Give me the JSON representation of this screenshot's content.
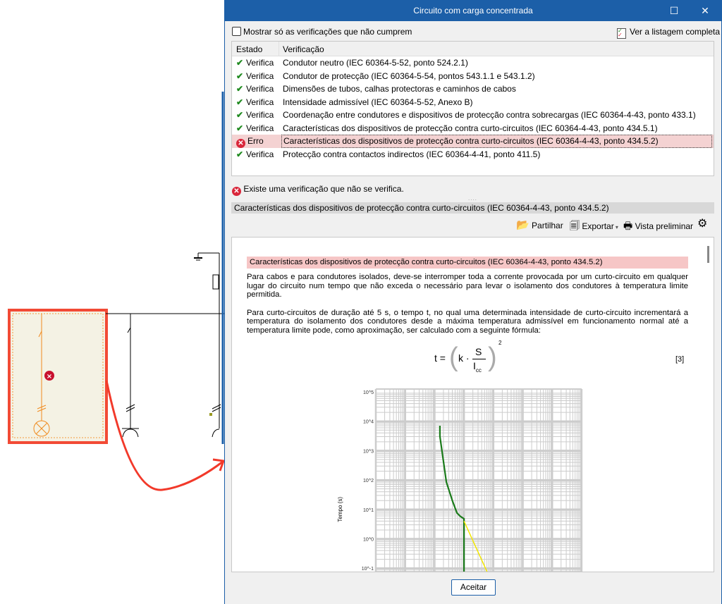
{
  "window": {
    "title": "Circuito com carga concentrada",
    "maximize_icon": "maximize-icon",
    "close_icon": "close-icon"
  },
  "filter": {
    "checkbox_label": "Mostrar só as verificações que não cumprem",
    "checked": false
  },
  "full_list_link": "Ver a listagem completa",
  "table": {
    "headers": [
      "Estado",
      "Verificação"
    ],
    "rows": [
      {
        "status": "Verifica",
        "check": "Condutor neutro (IEC 60364-5-52, ponto 524.2.1)",
        "ok": true
      },
      {
        "status": "Verifica",
        "check": "Condutor de protecção (IEC 60364-5-54, pontos 543.1.1 e 543.1.2)",
        "ok": true
      },
      {
        "status": "Verifica",
        "check": "Dimensões de tubos, calhas protectoras e caminhos de cabos",
        "ok": true
      },
      {
        "status": "Verifica",
        "check": "Intensidade admissível (IEC 60364-5-52, Anexo B)",
        "ok": true
      },
      {
        "status": "Verifica",
        "check": "Coordenação entre condutores e dispositivos de protecção contra sobrecargas (IEC 60364-4-43, ponto 433.1)",
        "ok": true
      },
      {
        "status": "Verifica",
        "check": "Características dos dispositivos de protecção contra curto-circuitos (IEC 60364-4-43, ponto 434.5.1)",
        "ok": true
      },
      {
        "status": "Erro",
        "check": "Características dos dispositivos de protecção contra curto-circuitos (IEC 60364-4-43, ponto 434.5.2)",
        "ok": false
      },
      {
        "status": "Verifica",
        "check": "Protecção contra contactos indirectos (IEC 60364-4-41, ponto 411.5)",
        "ok": true
      }
    ]
  },
  "status_message": "Existe uma verificação que não se verifica.",
  "section_title": "Características dos dispositivos de protecção contra curto-circuitos (IEC 60364-4-43, ponto 434.5.2)",
  "toolbar": {
    "share": "Partilhar",
    "export": "Exportar",
    "preview": "Vista preliminar"
  },
  "doc": {
    "heading": "Características dos dispositivos de protecção contra curto-circuitos (IEC 60364-4-43, ponto 434.5.2)",
    "p1": "Para cabos e para condutores isolados, deve-se interromper toda a corrente provocada por um curto-circuito em qualquer lugar do circuito num tempo que não exceda o necessário para levar o isolamento dos condutores à temperatura limite permitida.",
    "p2": "Para curto-circuitos de duração até 5 s, o tempo t, no qual uma determinada intensidade de curto-circuito incrementará a temperatura do isolamento dos condutores desde a máxima temperatura admissível em funcionamento normal até a temperatura limite pode, como aproximação, ser calculado com a seguinte fórmula:",
    "formula": {
      "lhs": "t =",
      "k": "k ·",
      "num": "S",
      "den": "I",
      "den_sub": "cc",
      "exp": "2",
      "ref": "[3]"
    }
  },
  "chart_data": {
    "type": "line",
    "ylabel": "Tempo (s)",
    "yscale": "log",
    "y_ticks": [
      "10^5",
      "10^4",
      "10^3",
      "10^2",
      "10^1",
      "10^0",
      "10^-1"
    ],
    "y_tick_exponents": [
      5,
      4,
      3,
      2,
      1,
      0,
      -1
    ],
    "ylim_log": [
      -1,
      5
    ],
    "x_decades": 7,
    "grid": true,
    "series": [
      {
        "name": "device-curve",
        "color": "#1a7a1a",
        "points_log": [
          [
            2.18,
            3.85
          ],
          [
            2.18,
            3.49
          ],
          [
            2.4,
            1.93
          ],
          [
            2.61,
            1.28
          ],
          [
            2.76,
            0.88
          ],
          [
            2.88,
            0.76
          ],
          [
            3.0,
            0.68
          ],
          [
            3.0,
            -1.2
          ]
        ]
      },
      {
        "name": "cable-limit",
        "color": "#f2e600",
        "points_log": [
          [
            3.0,
            0.6
          ],
          [
            3.82,
            -1.2
          ]
        ]
      }
    ]
  },
  "footer": {
    "accept": "Aceitar"
  },
  "colors": {
    "accent": "#1c5fa8",
    "error": "#d9263a",
    "ok": "#1f8a1f",
    "highlight": "#f4d2d2"
  }
}
